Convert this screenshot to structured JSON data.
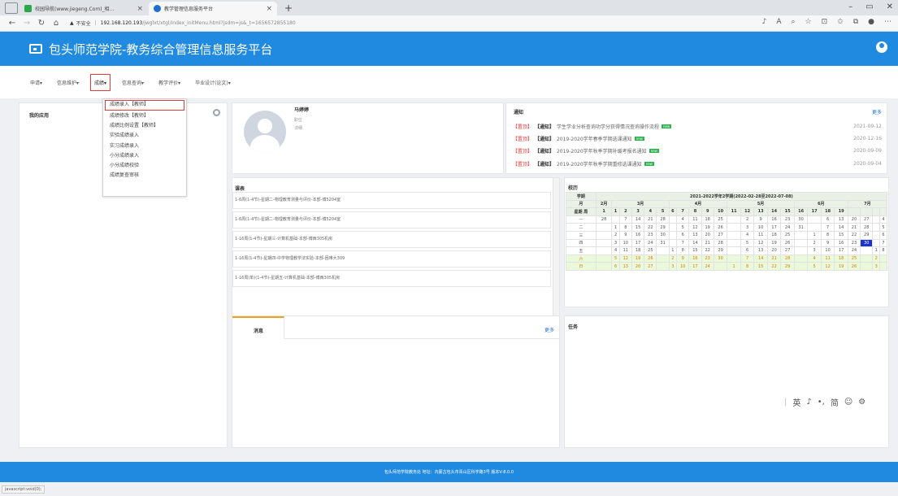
{
  "browser": {
    "tabs": [
      {
        "label": "校园导航(www.jiegeng.Com)_相...",
        "color": "#2aa84a"
      },
      {
        "label": "教学管理信息服务平台",
        "color": "#1f6fd0"
      }
    ],
    "new_tab": "+",
    "address": {
      "security": "不安全",
      "host": "192.168.120.193",
      "path": "/jwglxt/xtgl/index_initMenu.html?jsdm=js&_t=1656572855180"
    }
  },
  "app": {
    "title": "包头师范学院-教务综合管理信息服务平台"
  },
  "menu": {
    "items": [
      "申请▾",
      "信息维护▾",
      "成绩▾",
      "信息查询▾",
      "教学评价▾",
      "毕业设计(论文)▾"
    ]
  },
  "dropdown": {
    "items": [
      "成绩录入【教师】",
      "成绩修改【教师】",
      "成绩比例设置【教师】",
      "实验成绩录入",
      "实习成绩录入",
      "小分成绩录入",
      "小分成绩校验",
      "成绩复查审核"
    ]
  },
  "my_apps": {
    "title": "我的应用"
  },
  "profile": {
    "name": "马婷婷",
    "line1": "职位",
    "line2": "详细"
  },
  "notice": {
    "title": "通知",
    "more": "更多",
    "items": [
      {
        "tag1": "【置顶】",
        "tag2": "【通知】",
        "text": "学生学业分析查询功学分获得情况查询操作流程",
        "badge": "new",
        "date": "2021-09-12"
      },
      {
        "tag1": "【置顶】",
        "tag2": "【通知】",
        "text": "2019-2020学年春季学期选课通知",
        "badge": "new",
        "date": "2020-12-16"
      },
      {
        "tag1": "【置顶】",
        "tag2": "【通知】",
        "text": "2019-2020学年秋季学期补缓考报名通知",
        "badge": "new",
        "date": "2020-09-09"
      },
      {
        "tag1": "【置顶】",
        "tag2": "【通知】",
        "text": "2019-2020学年秋季学期重修选课通知",
        "badge": "new",
        "date": "2020-09-04"
      }
    ]
  },
  "course": {
    "title": "课表",
    "rows": [
      "1-6周(1-4节)-星期二-物理教育测量与评价-本部-博5204室",
      "1-6周(1-4节)-星期二-物理教育测量与评价-本部-博5204室",
      "1-16周(1-4节)-星期三-计算机基础-本部-博西305机房",
      "1-16周(1-4节)-星期四-中学物理教学法实验-本部-困难大309",
      "1-16周(单)(1-4节)-星期五-计算机基础-本部-博西305机房"
    ]
  },
  "calendar": {
    "title": "校历",
    "header_label": "学期",
    "term": "2021-2022学年2学期(2022-02-28至2022-07-08)",
    "month_row_label": "月",
    "months": [
      "2月",
      "3月",
      "4月",
      "5月",
      "6月",
      "7月"
    ],
    "week_row_label": "星期 周",
    "weeks": [
      "1",
      "1",
      "2",
      "3",
      "4",
      "5",
      "6",
      "7",
      "8",
      "9",
      "10",
      "11",
      "12",
      "13",
      "14",
      "15",
      "16",
      "17",
      "18",
      "19"
    ],
    "rows": [
      {
        "day": "一",
        "cells": [
          "28",
          "",
          "7",
          "14",
          "21",
          "28",
          "",
          "4",
          "11",
          "18",
          "25",
          "",
          "2",
          "9",
          "16",
          "23",
          "30",
          "",
          "6",
          "13",
          "20",
          "27",
          "",
          "4"
        ]
      },
      {
        "day": "二",
        "cells": [
          "",
          "1",
          "8",
          "15",
          "22",
          "29",
          "",
          "5",
          "12",
          "19",
          "26",
          "",
          "3",
          "10",
          "17",
          "24",
          "31",
          "",
          "7",
          "14",
          "21",
          "28",
          "",
          "5"
        ]
      },
      {
        "day": "三",
        "cells": [
          "",
          "2",
          "9",
          "16",
          "23",
          "30",
          "",
          "6",
          "13",
          "20",
          "27",
          "",
          "4",
          "11",
          "18",
          "25",
          "",
          "1",
          "8",
          "15",
          "22",
          "29",
          "",
          "6"
        ]
      },
      {
        "day": "四",
        "cells": [
          "",
          "3",
          "10",
          "17",
          "24",
          "31",
          "",
          "7",
          "14",
          "21",
          "28",
          "",
          "5",
          "12",
          "19",
          "26",
          "",
          "2",
          "9",
          "16",
          "23",
          "30",
          "",
          "7"
        ]
      },
      {
        "day": "五",
        "cells": [
          "",
          "4",
          "11",
          "18",
          "25",
          "",
          "1",
          "8",
          "15",
          "22",
          "29",
          "",
          "6",
          "13",
          "20",
          "27",
          "",
          "3",
          "10",
          "17",
          "24",
          "",
          "1",
          "8"
        ]
      },
      {
        "day": "六",
        "cells": [
          "",
          "5",
          "12",
          "19",
          "26",
          "",
          "2",
          "9",
          "16",
          "23",
          "30",
          "",
          "7",
          "14",
          "21",
          "28",
          "",
          "4",
          "11",
          "18",
          "25",
          "",
          "2",
          ""
        ]
      },
      {
        "day": "日",
        "cells": [
          "",
          "6",
          "13",
          "20",
          "27",
          "",
          "3",
          "10",
          "17",
          "24",
          "",
          "1",
          "8",
          "15",
          "22",
          "29",
          "",
          "5",
          "12",
          "19",
          "26",
          "",
          "3",
          ""
        ]
      }
    ],
    "today_value": "30"
  },
  "messages": {
    "title": "消息",
    "more": "更多"
  },
  "tasks": {
    "title": "任务"
  },
  "ime": {
    "items": [
      "英",
      "♪",
      "•,",
      "简",
      "☺",
      "⚙"
    ]
  },
  "footer": {
    "text": "包头师范学院教务处 地址：内蒙古包头市青山区科学路3号 版本V-8.0.0"
  },
  "status": {
    "text": "javascript:void(0);"
  }
}
